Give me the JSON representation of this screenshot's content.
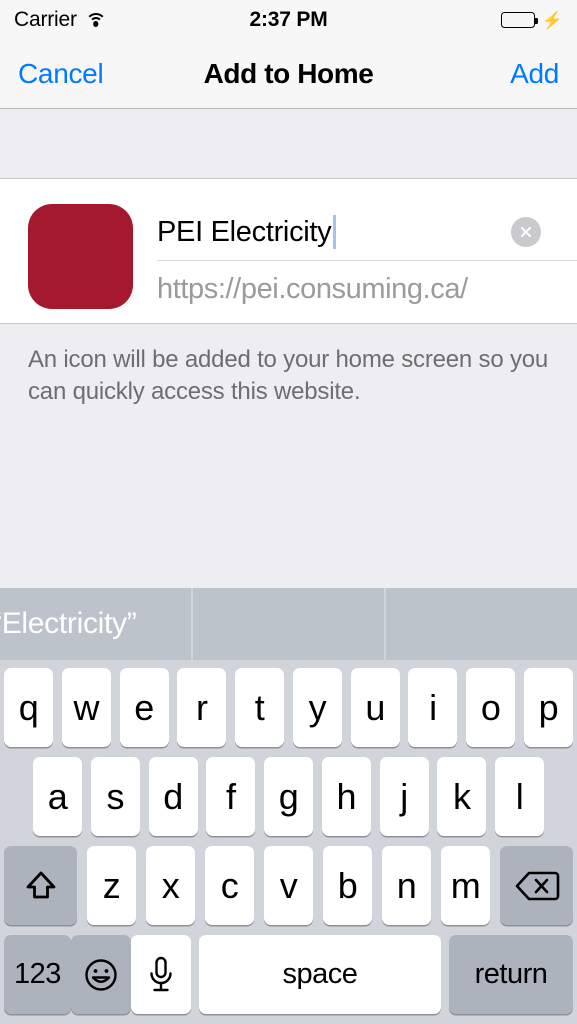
{
  "status_bar": {
    "carrier": "Carrier",
    "wifi_icon": "wifi-icon",
    "time": "2:37 PM",
    "battery_icon": "battery-full-icon",
    "charging_icon": "lightning-bolt-icon",
    "battery_color": "#4cd964"
  },
  "nav_bar": {
    "cancel_label": "Cancel",
    "title": "Add to Home",
    "add_label": "Add",
    "tint_color": "#007aff"
  },
  "form": {
    "icon_color": "#a5192e",
    "title_value": "PEI Electricity",
    "url_value": "https://pei.consuming.ca/",
    "clear_icon": "clear-circle-icon"
  },
  "note": "An icon will be added to your home screen so you can quickly access this website.",
  "keyboard": {
    "predictions": [
      "“Electricity”",
      "",
      ""
    ],
    "row1": [
      "q",
      "w",
      "e",
      "r",
      "t",
      "y",
      "u",
      "i",
      "o",
      "p"
    ],
    "row2": [
      "a",
      "s",
      "d",
      "f",
      "g",
      "h",
      "j",
      "k",
      "l"
    ],
    "row3": [
      "z",
      "x",
      "c",
      "v",
      "b",
      "n",
      "m"
    ],
    "shift_icon": "shift-arrow-icon",
    "backspace_icon": "backspace-icon",
    "numbers_label": "123",
    "emoji_icon": "emoji-smiley-icon",
    "dictation_icon": "microphone-icon",
    "space_label": "space",
    "return_label": "return"
  }
}
